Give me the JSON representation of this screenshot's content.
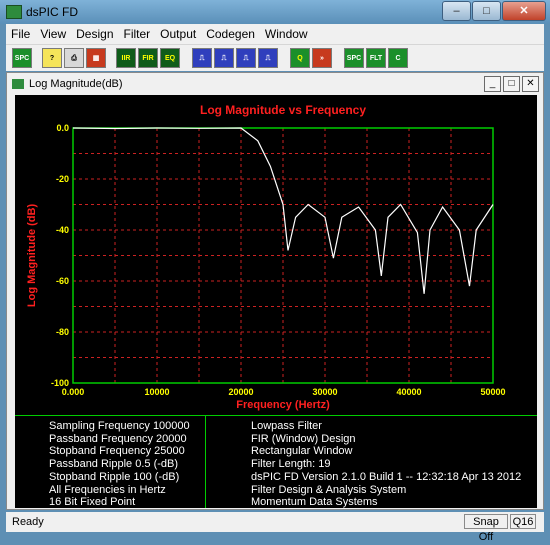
{
  "window": {
    "title": "dsPIC FD"
  },
  "menu": [
    "File",
    "View",
    "Design",
    "Filter",
    "Output",
    "Codegen",
    "Window"
  ],
  "toolbar": [
    "SPC",
    "?",
    "⎙",
    "▦",
    "IIR",
    "FIR",
    "EQ",
    "⎍",
    "⎍",
    "⎍",
    "⎍",
    "Q",
    "»",
    "SPC",
    "FLT",
    "C"
  ],
  "child": {
    "title": "Log Magnitude(dB)"
  },
  "chart_data": {
    "type": "line",
    "title": "Log Magnitude vs Frequency",
    "xlabel": "Frequency (Hertz)",
    "ylabel": "Log Magnitude (dB)",
    "xlim": [
      0,
      50000
    ],
    "ylim": [
      -100,
      0
    ],
    "x_ticks": [
      "0.000",
      "10000",
      "20000",
      "30000",
      "40000",
      "50000"
    ],
    "y_ticks": [
      "0.0",
      "-20",
      "-40",
      "-60",
      "-80",
      "-100"
    ],
    "grid": true,
    "colors": {
      "background": "#000000",
      "axes": "#00cc00",
      "grid": "#cc2222",
      "title": "#ff2020",
      "ticks": "#ffff00",
      "curve": "#ffffff"
    },
    "series": [
      {
        "x": [
          0,
          5000,
          10000,
          15000,
          20000,
          22000,
          23500,
          25000,
          25600,
          26500,
          28000,
          30000,
          31000,
          32000,
          34000,
          36000,
          36700,
          37500,
          39000,
          41000,
          41800,
          42500,
          44000,
          46000,
          47200,
          48000,
          50000
        ],
        "y": [
          0,
          -0.2,
          0,
          -0.1,
          0,
          -5,
          -15,
          -30,
          -48,
          -35,
          -30,
          -35,
          -51,
          -35,
          -31,
          -40,
          -58,
          -35,
          -30,
          -41,
          -65,
          -40,
          -31,
          -40,
          -62,
          -40,
          -30
        ]
      }
    ]
  },
  "info": {
    "left": [
      "Sampling Frequency 100000",
      "Passband Frequency 20000",
      "Stopband Frequency 25000",
      "Passband Ripple 0.5 (-dB)",
      "Stopband Ripple 100 (-dB)",
      "All Frequencies in Hertz",
      "16 Bit Fixed Point"
    ],
    "right": [
      "Lowpass Filter",
      "FIR (Window) Design",
      "Rectangular Window",
      "Filter Length: 19",
      "dsPIC FD Version 2.1.0 Build 1 -- 12:32:18 Apr 13 2012",
      "Filter Design & Analysis System",
      "Momentum Data Systems"
    ]
  },
  "status": {
    "text": "Ready",
    "snap": "Snap Off",
    "format": "Q16"
  }
}
